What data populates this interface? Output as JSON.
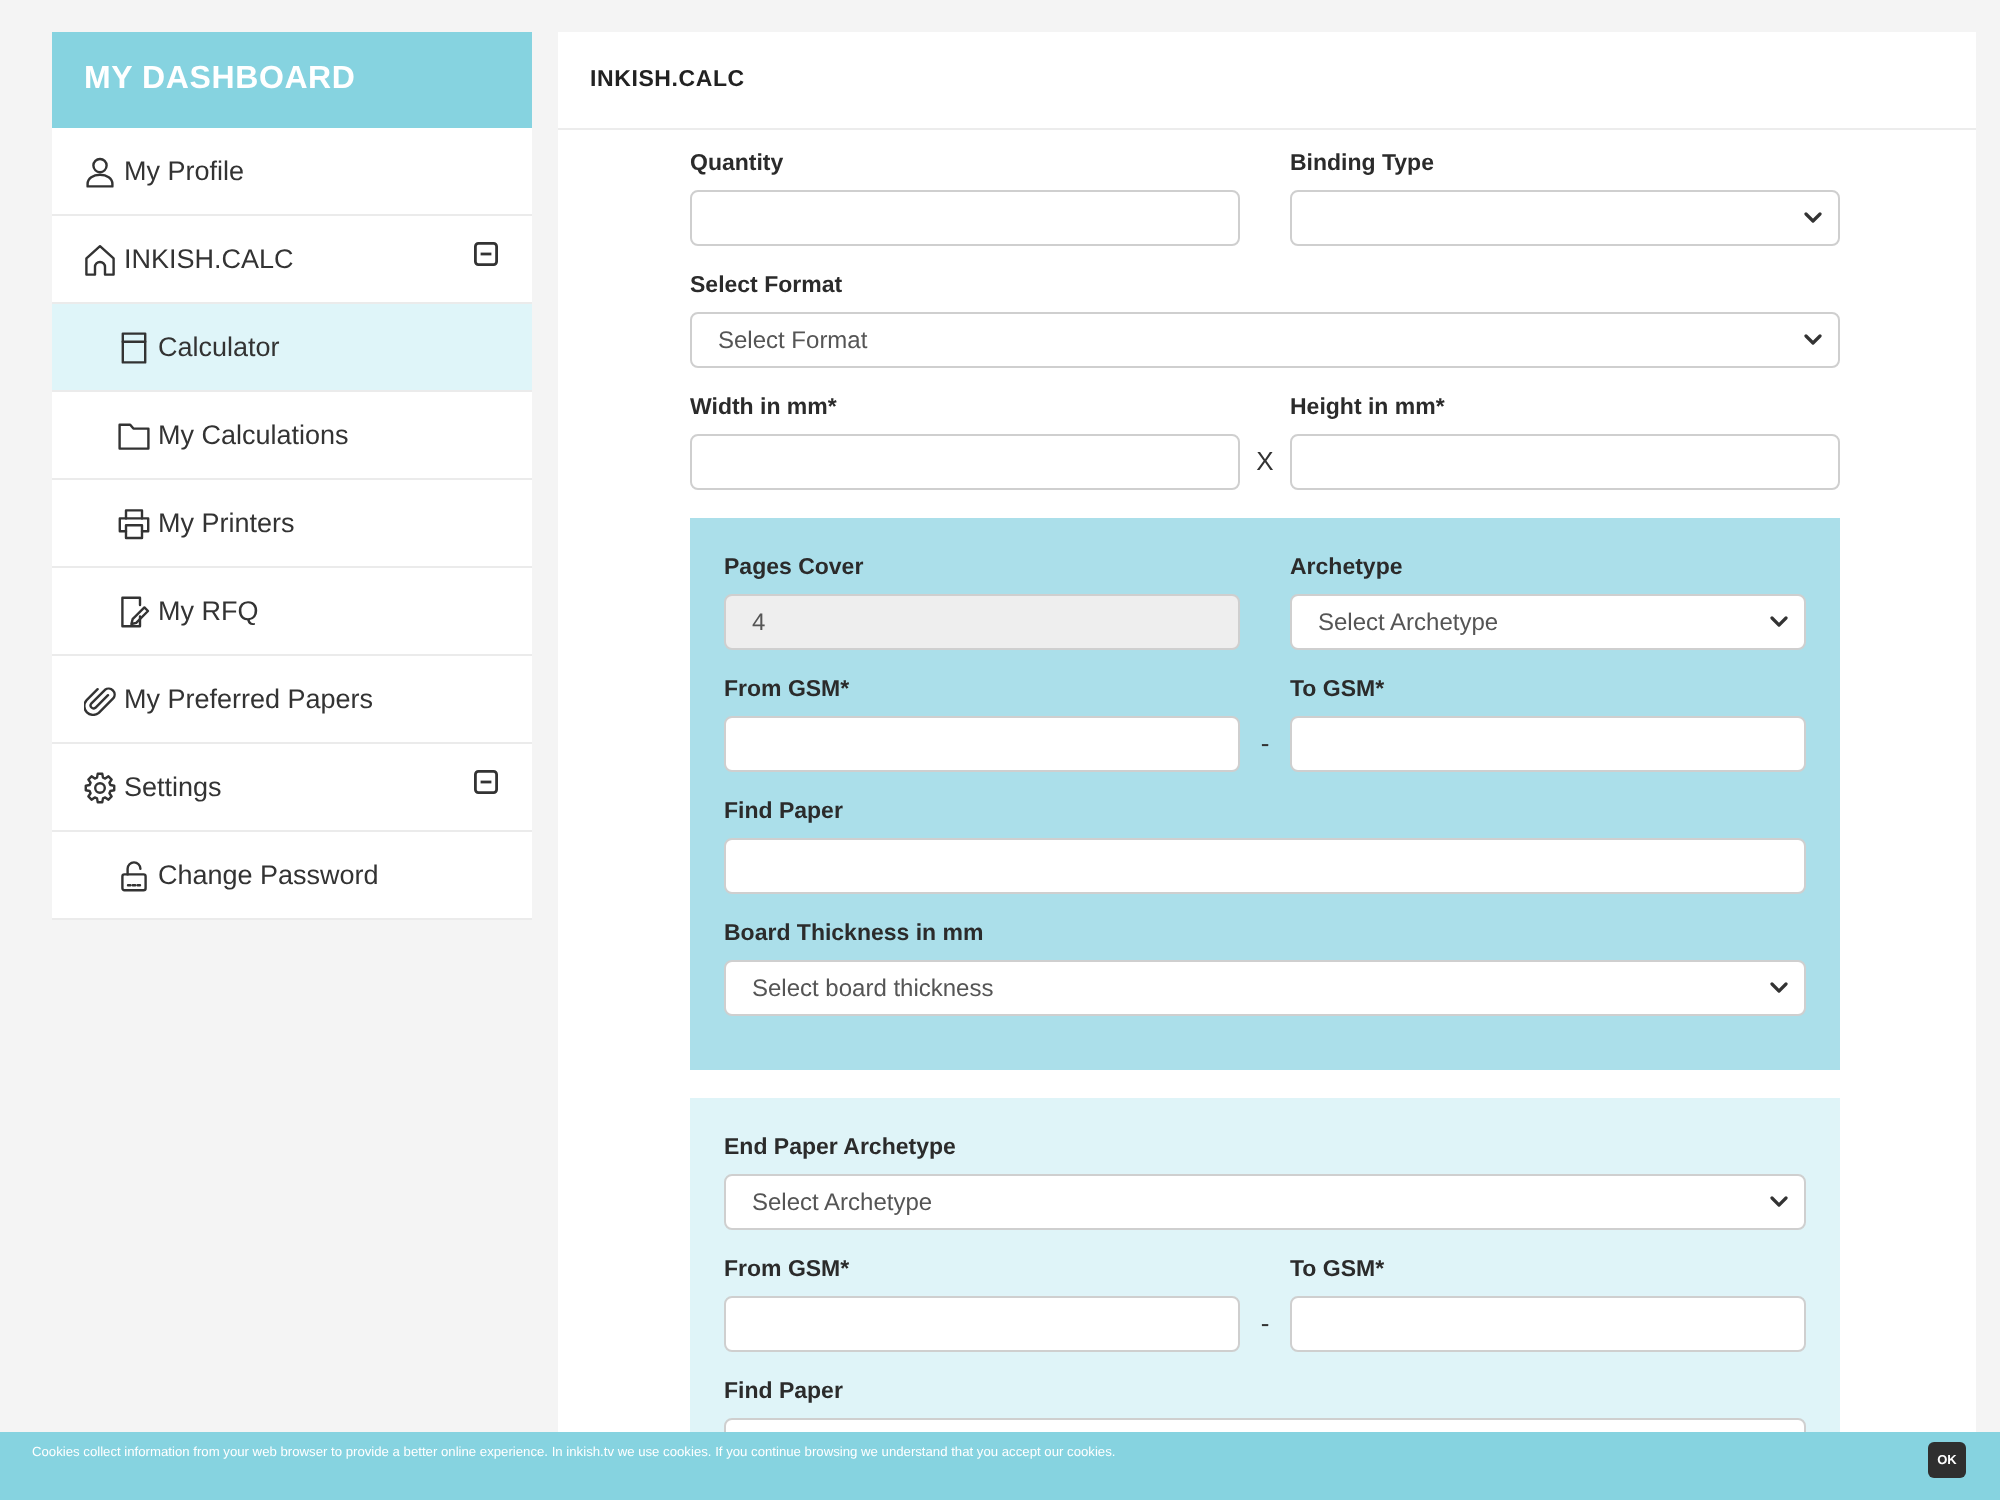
{
  "sidebar": {
    "title": "MY DASHBOARD",
    "items": [
      {
        "label": "My Profile",
        "selected": false
      },
      {
        "label": "INKISH.CALC",
        "selected": false,
        "expanded": true,
        "children": [
          {
            "label": "Calculator",
            "selected": true
          },
          {
            "label": "My Calculations",
            "selected": false
          },
          {
            "label": "My Printers",
            "selected": false
          },
          {
            "label": "My RFQ",
            "selected": false
          }
        ]
      },
      {
        "label": "My Preferred Papers",
        "selected": false
      },
      {
        "label": "Settings",
        "selected": false,
        "expanded": true,
        "children": [
          {
            "label": "Change Password",
            "selected": false
          }
        ]
      }
    ]
  },
  "main": {
    "title": "INKISH.CALC",
    "sections": [
      {
        "kind": "plain",
        "rows": [
          {
            "fields": [
              {
                "label": "Quantity",
                "kind": "input",
                "disabled": false
              },
              {
                "label": "Binding Type",
                "kind": "select",
                "disabled": false
              }
            ]
          },
          {
            "fields": [
              {
                "label": "Select Format",
                "kind": "select",
                "value": "Select Format",
                "disabled": false
              }
            ]
          },
          {
            "separator": "X",
            "fields": [
              {
                "label": "Width in mm*",
                "kind": "input",
                "disabled": false
              },
              {
                "label": "Height in mm*",
                "kind": "input",
                "disabled": false
              }
            ]
          }
        ]
      },
      {
        "kind": "highlight",
        "rows": [
          {
            "fields": [
              {
                "label": "Pages Cover",
                "kind": "input",
                "value": "4",
                "disabled": true
              },
              {
                "label": "Archetype",
                "kind": "select",
                "value": "Select Archetype",
                "disabled": false
              }
            ]
          },
          {
            "separator": "-",
            "fields": [
              {
                "label": "From GSM*",
                "kind": "input",
                "disabled": false
              },
              {
                "label": "To GSM*",
                "kind": "input",
                "disabled": false
              }
            ]
          },
          {
            "fields": [
              {
                "label": "Find Paper",
                "kind": "input",
                "disabled": false
              }
            ]
          },
          {
            "fields": [
              {
                "label": "Board Thickness in mm",
                "kind": "select",
                "value": "Select board thickness",
                "disabled": false
              }
            ]
          }
        ]
      },
      {
        "kind": "tint",
        "rows": [
          {
            "fields": [
              {
                "label": "End Paper Archetype",
                "kind": "select",
                "value": "Select Archetype",
                "disabled": false
              }
            ]
          },
          {
            "separator": "-",
            "fields": [
              {
                "label": "From GSM*",
                "kind": "input",
                "disabled": false
              },
              {
                "label": "To GSM*",
                "kind": "input",
                "disabled": false
              }
            ]
          },
          {
            "fields": [
              {
                "label": "Find Paper",
                "kind": "input",
                "disabled": false
              }
            ]
          }
        ]
      }
    ]
  },
  "cookie_bar": {
    "text": "Cookies collect information from your web browser to provide a better online experience. In inkish.tv we use cookies. If you continue browsing we understand that you accept our cookies.",
    "button": "OK"
  }
}
